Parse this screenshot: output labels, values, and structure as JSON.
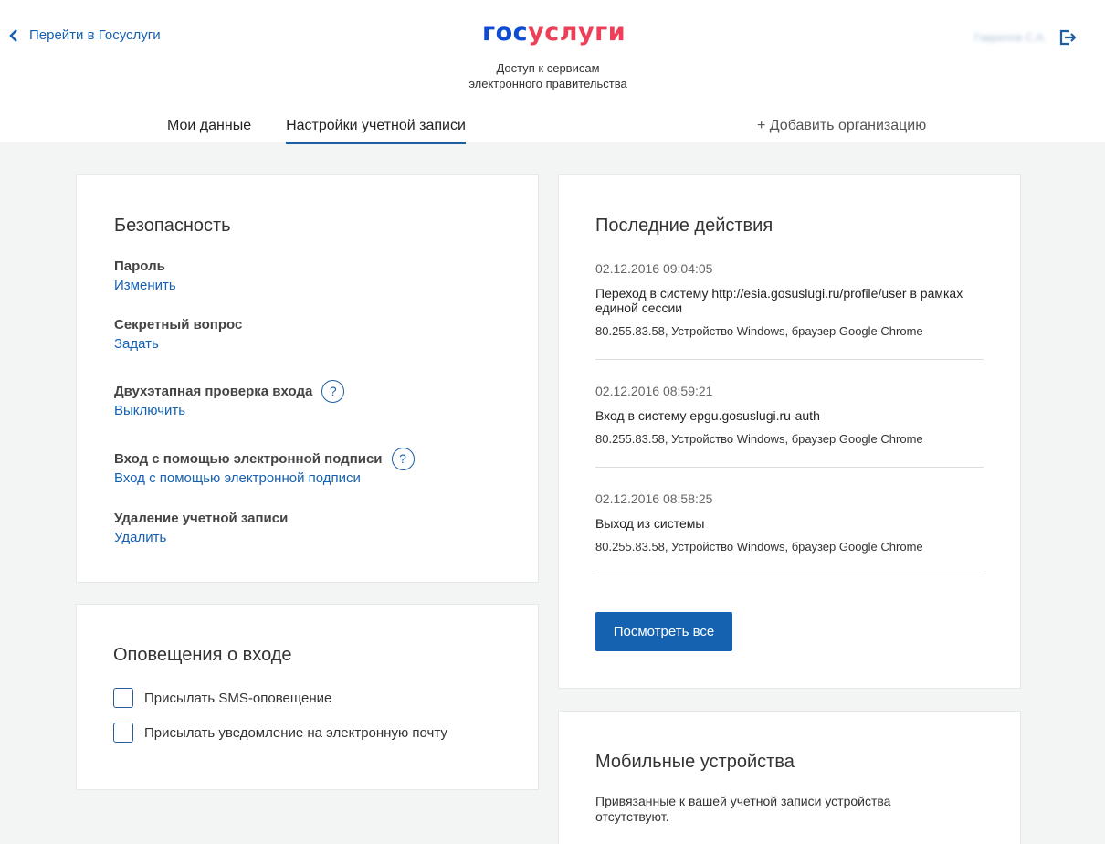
{
  "header": {
    "back_label": "Перейти в Госуслуги",
    "logo_part1": "гос",
    "logo_part2": "услуги",
    "subtitle_line1": "Доступ к сервисам",
    "subtitle_line2": "электронного правительства",
    "user_name": "Гаврилов С.А."
  },
  "tabs": [
    {
      "label": "Мои данные",
      "active": false
    },
    {
      "label": "Настройки учетной записи",
      "active": true
    }
  ],
  "add_org_label": "+ Добавить организацию",
  "security": {
    "title": "Безопасность",
    "items": [
      {
        "label": "Пароль",
        "link": "Изменить",
        "help": false
      },
      {
        "label": "Секретный вопрос",
        "link": "Задать",
        "help": false
      },
      {
        "label": "Двухэтапная проверка входа",
        "link": "Выключить",
        "help": true
      },
      {
        "label": "Вход с помощью электронной подписи",
        "link": "Вход с помощью электронной подписи",
        "help": true
      },
      {
        "label": "Удаление учетной записи",
        "link": "Удалить",
        "help": false
      }
    ],
    "help_glyph": "?"
  },
  "notifications": {
    "title": "Оповещения о входе",
    "options": [
      {
        "label": "Присылать SMS-оповещение",
        "checked": false
      },
      {
        "label": "Присылать уведомление на электронную почту",
        "checked": false
      }
    ]
  },
  "recent": {
    "title": "Последние действия",
    "actions": [
      {
        "date": "02.12.2016 09:04:05",
        "desc": "Переход в систему http://esia.gosuslugi.ru/profile/user в рамках единой сессии",
        "meta": "80.255.83.58, Устройство Windows, браузер Google Chrome"
      },
      {
        "date": "02.12.2016 08:59:21",
        "desc": "Вход в систему epgu.gosuslugi.ru-auth",
        "meta": "80.255.83.58, Устройство Windows, браузер Google Chrome"
      },
      {
        "date": "02.12.2016 08:58:25",
        "desc": "Выход из системы",
        "meta": "80.255.83.58, Устройство Windows, браузер Google Chrome"
      }
    ],
    "view_all_label": "Посмотреть все"
  },
  "mobile": {
    "title": "Мобильные устройства",
    "text": "Привязанные к вашей учетной записи устройства отсутствуют."
  },
  "colors": {
    "accent": "#1563b0",
    "logo_blue": "#0d4cd3",
    "logo_red": "#ee3f58",
    "background": "#f3f4f4"
  }
}
